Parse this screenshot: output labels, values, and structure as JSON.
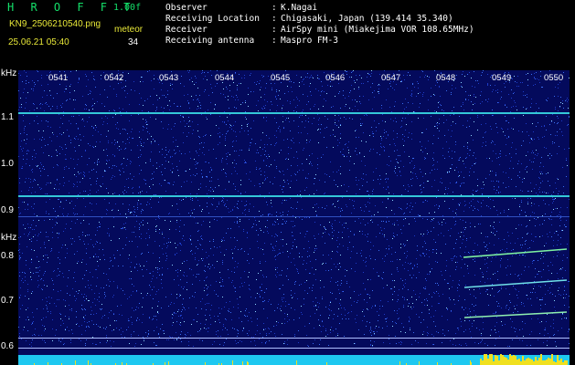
{
  "app": {
    "brand": "H R O F F T",
    "version": "1.00f",
    "filename": "KN9_2506210540.png",
    "mode": "meteor",
    "datetime": "25.06.21 05:40",
    "count": "34"
  },
  "meta": [
    {
      "key": "Observer",
      "sep": ":",
      "value": "K.Nagai"
    },
    {
      "key": "Receiving Location",
      "sep": ":",
      "value": "Chigasaki, Japan (139.414 35.340)"
    },
    {
      "key": "Receiver",
      "sep": ":",
      "value": "AirSpy mini (Miakejima VOR 108.65MHz)"
    },
    {
      "key": "Receiving antenna",
      "sep": ":",
      "value": "Maspro FM-3"
    }
  ],
  "axis": {
    "unit_top": "kHz",
    "unit_bottom": "kHz",
    "y_ticks": [
      "1.1",
      "1.0",
      "0.9",
      "0.8",
      "0.7",
      "0.6"
    ],
    "x_ticks": [
      "0541",
      "0542",
      "0543",
      "0544",
      "0545",
      "0546",
      "0547",
      "0548",
      "0549",
      "0550"
    ]
  },
  "colors": {
    "background": "#000000",
    "plot_bg": "#040a5c",
    "brand": "#14e06a",
    "accent": "#e8e838",
    "carrier": "#34c8d8",
    "baseline_cyan": "#1ec8f0",
    "baseline_yellow": "#f0e020"
  }
}
